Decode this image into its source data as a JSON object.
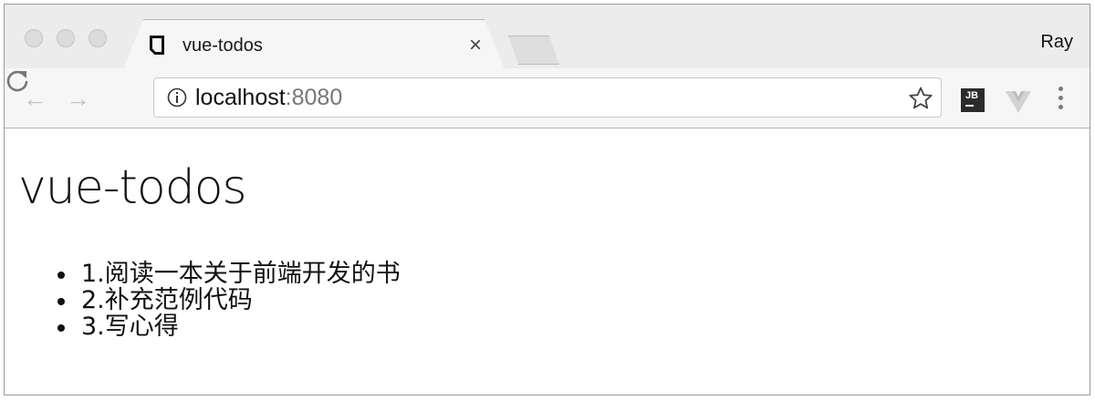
{
  "browser": {
    "profile_name": "Ray",
    "tab": {
      "title": "vue-todos",
      "close_glyph": "×"
    },
    "address_bar": {
      "host": "localhost",
      "port": ":8080"
    },
    "icons": [
      "favicon-icon",
      "info-icon",
      "star-icon",
      "reload-icon",
      "jetbrains-extension-icon",
      "vue-devtools-icon",
      "menu-icon"
    ],
    "extension_label": "JB"
  },
  "page": {
    "title": "vue-todos",
    "todos": [
      "1.阅读一本关于前端开发的书",
      "2.补充范例代码",
      "3.写心得"
    ]
  }
}
